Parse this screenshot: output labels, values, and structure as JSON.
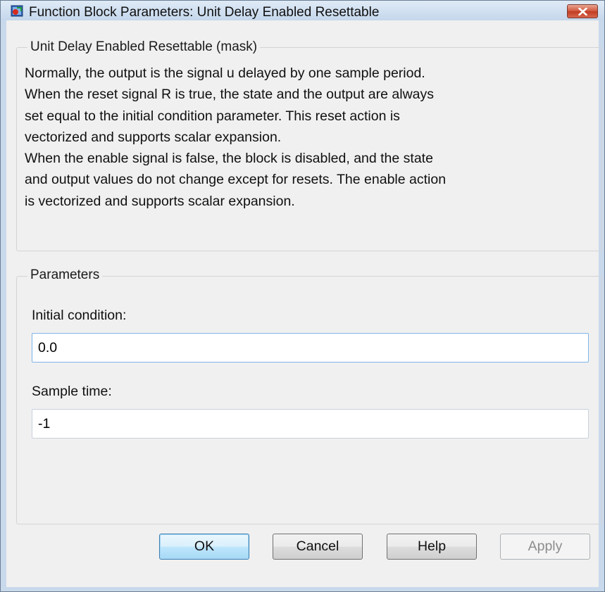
{
  "window": {
    "title": "Function Block Parameters: Unit Delay Enabled Resettable"
  },
  "description_group": {
    "legend": "Unit Delay Enabled Resettable (mask)",
    "text": "Normally, the output is the signal u delayed by one sample period.\nWhen the reset signal R is true, the state and the output are always\nset equal to the initial condition parameter.  This reset action is\nvectorized and supports scalar expansion.\nWhen the enable signal is false, the block is disabled, and the state\nand output values do not change except for resets.  The enable action\nis vectorized and supports scalar expansion."
  },
  "parameters_group": {
    "legend": "Parameters",
    "initial_condition": {
      "label": "Initial condition:",
      "value": "0.0"
    },
    "sample_time": {
      "label": "Sample time:",
      "value": "-1"
    }
  },
  "buttons": {
    "ok": "OK",
    "cancel": "Cancel",
    "help": "Help",
    "apply": "Apply"
  },
  "icons": {
    "app": "simulink-block-icon",
    "close": "close-icon"
  },
  "colors": {
    "title_bar": "#c9d9ec",
    "close_button": "#c8452c",
    "dialog_background": "#f0f0f0"
  }
}
